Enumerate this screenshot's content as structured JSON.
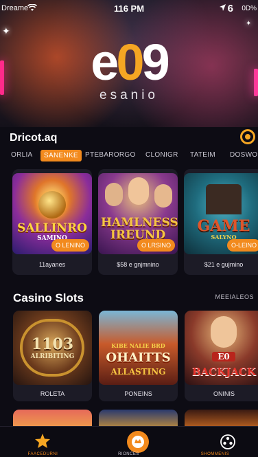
{
  "status_bar": {
    "carrier": "Dreamе",
    "time": "116 PM",
    "signal_number": "6",
    "battery": "0D%"
  },
  "brand": {
    "logo_e": "e",
    "logo_zero": "0",
    "logo_nine": "9",
    "subtitle": "esanio"
  },
  "featured": {
    "heading": "Driсot.aq",
    "tabs": [
      {
        "label": "ORLIA",
        "active": false
      },
      {
        "label": "SANENKE",
        "active": true
      },
      {
        "label": "PTEBARORGO",
        "active": false
      },
      {
        "label": "CLONIGR",
        "active": false
      },
      {
        "label": "TATEIM",
        "active": false
      },
      {
        "label": "DOSWO",
        "active": false
      }
    ],
    "cards": [
      {
        "art_line1": "SALLINRO",
        "art_line2": "SAMINO",
        "badge": "O LENINO",
        "caption": "11ayanes"
      },
      {
        "art_line1": "HAMLNESS",
        "art_line2": "IREUND",
        "badge": "O LRSINO",
        "caption": "$58 e gnjmnino"
      },
      {
        "art_line1": "GAME",
        "art_line2": "SALYNQ",
        "badge": "O-LEINO",
        "caption": "$21 e gujmino"
      }
    ]
  },
  "slots": {
    "heading": "Casino Slots",
    "see_all": "MEEIALEOS",
    "items": [
      {
        "art_line1": "1103",
        "art_line2": "ALRIBITING",
        "caption": "ROLETA"
      },
      {
        "art_line1": "KIBE NALIE BRD",
        "art_line2": "OHAITTS",
        "art_line3": "ALLASTING",
        "caption": "PONEINS"
      },
      {
        "art_line1": "E0",
        "art_line2": "BACKJACK",
        "caption": "ONINIS"
      }
    ]
  },
  "bottom_nav": [
    {
      "label": "FAACEDURNI",
      "icon": "star-icon"
    },
    {
      "label": "RIONCES",
      "icon": "chip-icon"
    },
    {
      "label": "SHOMMENIS",
      "icon": "poker-chip-icon"
    }
  ],
  "colors": {
    "accent": "#f28a1d",
    "background": "#0d0c14",
    "card": "#1c1b26"
  }
}
